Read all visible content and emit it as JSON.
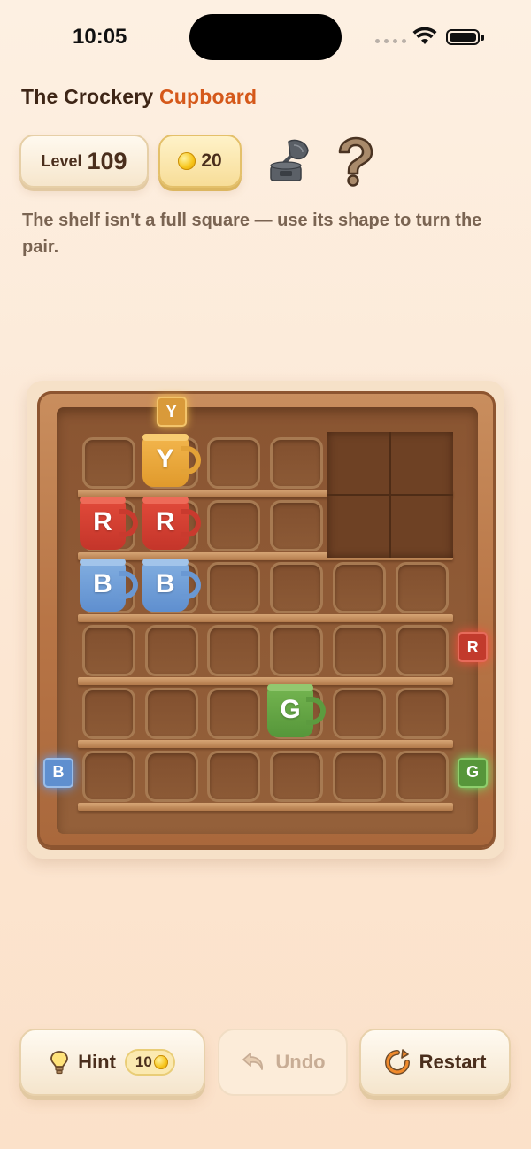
{
  "status_bar": {
    "time": "10:05"
  },
  "header": {
    "title_part1": "The Crockery ",
    "title_part2": "Cupboard",
    "title_accent_color": "#d5581a"
  },
  "stats": {
    "level_label": "Level",
    "level_number": "109",
    "coins": "20"
  },
  "icons": [
    "gramophone-icon",
    "help-icon",
    "hint-bulb-icon",
    "undo-icon",
    "restart-icon",
    "coin-icon"
  ],
  "instruction": "The shelf isn't a full square — use its shape to turn the pair.",
  "board": {
    "rows": 6,
    "cols": 6,
    "blocked_cells": [
      [
        0,
        4
      ],
      [
        0,
        5
      ],
      [
        1,
        4
      ],
      [
        1,
        5
      ]
    ],
    "mugs": [
      {
        "row": 0,
        "col": 1,
        "color": "yellow",
        "letter": "Y"
      },
      {
        "row": 1,
        "col": 0,
        "color": "red",
        "letter": "R"
      },
      {
        "row": 1,
        "col": 1,
        "color": "red",
        "letter": "R"
      },
      {
        "row": 2,
        "col": 0,
        "color": "blue",
        "letter": "B"
      },
      {
        "row": 2,
        "col": 1,
        "color": "blue",
        "letter": "B"
      },
      {
        "row": 4,
        "col": 3,
        "color": "green",
        "letter": "G"
      }
    ],
    "targets": [
      {
        "side": "top",
        "index": 1,
        "color": "yellow",
        "letter": "Y"
      },
      {
        "side": "right",
        "index": 3,
        "color": "red",
        "letter": "R"
      },
      {
        "side": "left",
        "index": 5,
        "color": "blue",
        "letter": "B"
      },
      {
        "side": "right",
        "index": 5,
        "color": "green",
        "letter": "G"
      }
    ]
  },
  "controls": {
    "hint_label": "Hint",
    "hint_cost": "10",
    "undo_label": "Undo",
    "restart_label": "Restart"
  }
}
